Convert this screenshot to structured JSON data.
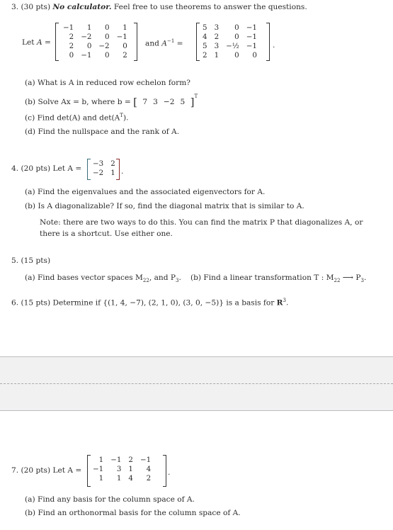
{
  "problems": [
    {
      "number": "3.",
      "points": "(30 pts)",
      "emphasis": "No calculator.",
      "intro": "Feel free to use theorems to answer the questions.",
      "let_label": "Let",
      "matrix_name": "A",
      "eq": "=",
      "matrix_A": [
        [
          "−1",
          "1",
          "0",
          "1"
        ],
        [
          "2",
          "−2",
          "0",
          "−1"
        ],
        [
          "2",
          "0",
          "−2",
          "0"
        ],
        [
          "0",
          "−1",
          "0",
          "2"
        ]
      ],
      "and_label": "and",
      "inverse_name": "A",
      "inverse_sup": "−1",
      "matrix_A_inv": [
        [
          "5",
          "3",
          "0",
          "−1"
        ],
        [
          "4",
          "2",
          "0",
          "−1"
        ],
        [
          "5",
          "3",
          "−½",
          "−1"
        ],
        [
          "2",
          "1",
          "0",
          "0"
        ]
      ],
      "half_num": "1",
      "half_den": "2",
      "parts": [
        {
          "label": "(a)",
          "text": "What is A in reduced row echelon form?"
        },
        {
          "label": "(b)",
          "text": "Solve Ax = b, where b =",
          "vector_b": [
            "7",
            "3",
            "−2",
            "5"
          ],
          "transpose": "T"
        },
        {
          "label": "(c)",
          "text": "Find det(A) and det(A",
          "sup": "T",
          "tail": ")."
        },
        {
          "label": "(d)",
          "text": "Find the nullspace and the rank of A."
        }
      ]
    },
    {
      "number": "4.",
      "points": "(20 pts)",
      "let_label": "Let A =",
      "matrix_A": [
        [
          "−3",
          "2"
        ],
        [
          "−2",
          "1"
        ]
      ],
      "parts": [
        {
          "label": "(a)",
          "text": "Find the eigenvalues and the associated eigenvectors for A."
        },
        {
          "label": "(b)",
          "text": "Is A diagonalizable? If so, find the diagonal matrix that is similar to A."
        }
      ],
      "note_line1": "Note: there are two ways to do this. You can find the matrix P that diagonalizes A, or",
      "note_line2": "there is a shortcut. Use either one."
    },
    {
      "number": "5.",
      "points": "(15 pts)",
      "part_a": "(a) Find bases vector spaces M",
      "part_a_sub1": "22",
      "part_a_mid": ", and P",
      "part_a_sub2": "3",
      "part_a_end": ".",
      "part_b": "(b) Find a linear transformation T : M",
      "part_b_sub1": "22",
      "part_b_arrow": "⟶",
      "part_b_p": "P",
      "part_b_sub2": "3",
      "part_b_end": "."
    },
    {
      "number": "6.",
      "points": "(15 pts)",
      "text": "Determine if {(1, 4, −7), (2, 1, 0), (3, 0, −5)} is a basis for ",
      "bold_R": "R",
      "sup": "3",
      "end": "."
    },
    {
      "number": "7.",
      "points": "(20 pts)",
      "let_label": "Let A =",
      "matrix_A": [
        [
          "1",
          "−1",
          "2",
          "−1"
        ],
        [
          "−1",
          "3",
          "1",
          "4"
        ],
        [
          "1",
          "1",
          "4",
          "2"
        ]
      ],
      "parts": [
        {
          "label": "(a)",
          "text": "Find any basis for the column space of A."
        },
        {
          "label": "(b)",
          "text": "Find an orthonormal basis for the column space of A."
        }
      ]
    }
  ]
}
